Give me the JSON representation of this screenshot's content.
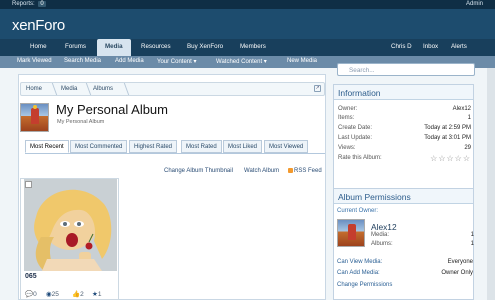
{
  "header": {
    "reports_label": "Reports:",
    "reports_count": "0",
    "admin_link": "Admin",
    "logo_text": "xenForo"
  },
  "nav": [
    {
      "label": "Home",
      "active": false
    },
    {
      "label": "Forums",
      "active": false
    },
    {
      "label": "Media",
      "active": true
    },
    {
      "label": "Resources",
      "active": false
    },
    {
      "label": "Buy XenForo",
      "active": false
    },
    {
      "label": "Members",
      "active": false
    }
  ],
  "user_nav": [
    {
      "label": "Chris D"
    },
    {
      "label": "Inbox"
    },
    {
      "label": "Alerts"
    }
  ],
  "subnav": [
    {
      "label": "Mark Viewed"
    },
    {
      "label": "Search Media"
    },
    {
      "label": "Add Media"
    },
    {
      "label": "Your Content ▾"
    },
    {
      "label": "Watched Content ▾"
    },
    {
      "label": "New Media"
    }
  ],
  "breadcrumb": [
    "Home",
    "Media",
    "Albums"
  ],
  "album": {
    "title": "My Personal Album",
    "subtitle": "My Personal Album"
  },
  "tabs": [
    {
      "label": "Most Recent",
      "active": true
    },
    {
      "label": "Most Commented",
      "active": false
    },
    {
      "label": "Highest Rated",
      "active": false
    },
    {
      "label": "Most Rated",
      "active": false
    },
    {
      "label": "Most Liked",
      "active": false
    },
    {
      "label": "Most Viewed",
      "active": false
    }
  ],
  "actions": {
    "change_thumbnail": "Change Album Thumbnail",
    "watch": "Watch Album",
    "rss": "RSS Feed"
  },
  "media": {
    "title": "065",
    "comments": "0",
    "views": "25",
    "likes": "2",
    "rating": "1"
  },
  "search": {
    "placeholder": "Search..."
  },
  "information": {
    "title": "Information",
    "rows": [
      {
        "label": "Owner:",
        "value": "Alex12"
      },
      {
        "label": "Items:",
        "value": "1"
      },
      {
        "label": "Create Date:",
        "value": "Today at 2:59 PM"
      },
      {
        "label": "Last Update:",
        "value": "Today at 3:01 PM"
      },
      {
        "label": "Views:",
        "value": "29"
      },
      {
        "label": "Rate this Album:",
        "value": ""
      }
    ],
    "rating_stars": "☆☆☆☆☆"
  },
  "permissions": {
    "title": "Album Permissions",
    "current_owner_label": "Current Owner:",
    "owner_name": "Alex12",
    "owner_media_label": "Media:",
    "owner_media_value": "1",
    "owner_albums_label": "Albums:",
    "owner_albums_value": "1",
    "can_view_label": "Can View Media:",
    "can_view_value": "Everyone",
    "can_add_label": "Can Add Media:",
    "can_add_value": "Owner Only",
    "change_link": "Change Permissions"
  },
  "colors": {
    "header_bg": "#1d4c6e",
    "nav_bg": "#183f5c",
    "subnav_bg": "#6b8ba8",
    "content_bg": "#f0f5f8"
  }
}
